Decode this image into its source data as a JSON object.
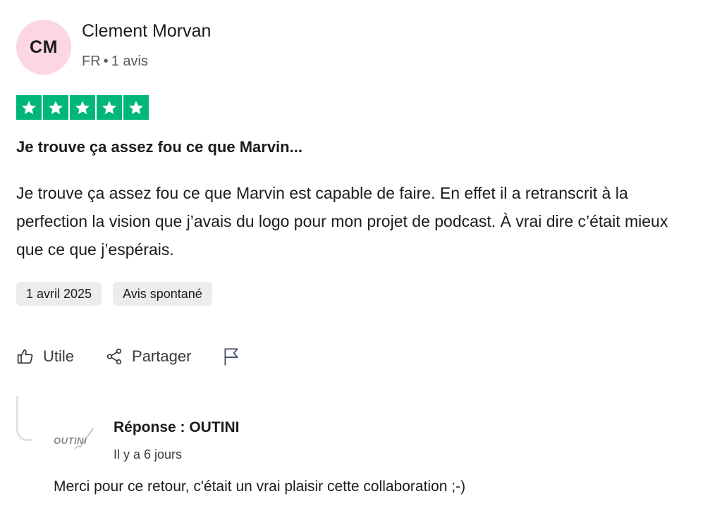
{
  "reviewer": {
    "initials": "CM",
    "name": "Clement Morvan",
    "country": "FR",
    "separator": "•",
    "reviews_count": "1 avis",
    "avatar_color": "#fcd6e4"
  },
  "rating": {
    "stars": 5,
    "max": 5,
    "star_color": "#00b67a"
  },
  "review": {
    "title": "Je trouve ça assez fou ce que Marvin...",
    "body": "Je trouve ça assez fou ce que Marvin est capable de faire. En effet il a retranscrit à la perfection la vision que j’avais du logo pour mon projet de podcast. À vrai dire c’était mieux que ce que j’espérais.",
    "date_tag": "1 avril 2025",
    "type_tag": "Avis spontané"
  },
  "actions": {
    "useful_label": "Utile",
    "share_label": "Partager",
    "useful_icon": "thumbs-up-icon",
    "share_icon": "share-icon",
    "report_icon": "flag-icon"
  },
  "reply": {
    "title": "Réponse : OUTINI",
    "date": "Il y a 6 jours",
    "text": "Merci pour ce retour, c'était un vrai plaisir cette collaboration ;-)",
    "logo_text": "OUTINI"
  }
}
